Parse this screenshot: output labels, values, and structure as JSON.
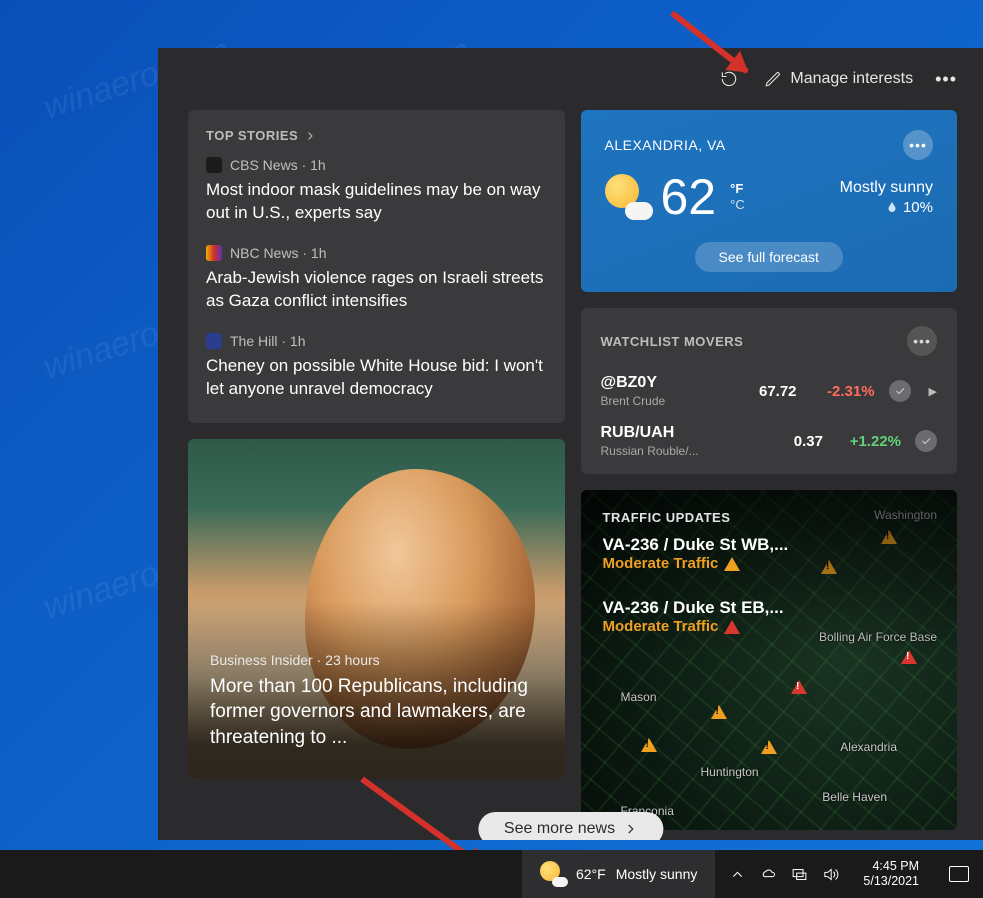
{
  "header": {
    "manage_label": "Manage interests"
  },
  "top_stories": {
    "title": "TOP STORIES",
    "items": [
      {
        "source": "CBS News",
        "time": "1h",
        "badge_bg": "#1b1b1b",
        "headline": "Most indoor mask guidelines may be on way out in U.S., experts say"
      },
      {
        "source": "NBC News",
        "time": "1h",
        "badge_bg": "#b04040",
        "headline": "Arab-Jewish violence rages on Israeli streets as Gaza conflict intensifies"
      },
      {
        "source": "The Hill",
        "time": "1h",
        "badge_bg": "#2a3d8f",
        "headline": "Cheney on possible White House bid: I won't let anyone unravel democracy"
      }
    ]
  },
  "weather": {
    "location": "ALEXANDRIA, VA",
    "temp": "62",
    "unit_f": "°F",
    "unit_c": "°C",
    "condition": "Mostly sunny",
    "precip": "10%",
    "forecast_btn": "See full forecast"
  },
  "watchlist": {
    "title": "WATCHLIST MOVERS",
    "items": [
      {
        "symbol": "@BZ0Y",
        "name": "Brent Crude",
        "price": "67.72",
        "pct": "-2.31%",
        "dir": "neg"
      },
      {
        "symbol": "RUB/UAH",
        "name": "Russian Rouble/...",
        "price": "0.37",
        "pct": "+1.22%",
        "dir": "pos"
      }
    ]
  },
  "feature_story": {
    "source": "Business Insider",
    "time": "23 hours",
    "headline": "More than 100 Republicans, including former governors and lawmakers, are threatening to ..."
  },
  "traffic": {
    "title": "TRAFFIC UPDATES",
    "items": [
      {
        "road": "VA-236 / Duke St WB,...",
        "status": "Moderate Traffic"
      },
      {
        "road": "VA-236 / Duke St EB,...",
        "status": "Moderate Traffic"
      }
    ],
    "map_labels": [
      "Washington",
      "Bolling Air Force Base",
      "Alexandria",
      "Huntington",
      "Belle Haven",
      "Franconia",
      "Mason"
    ]
  },
  "see_more": "See more news",
  "taskbar": {
    "temp": "62°F",
    "condition": "Mostly sunny",
    "time": "4:45 PM",
    "date": "5/13/2021"
  },
  "watermark": "winaero.com"
}
